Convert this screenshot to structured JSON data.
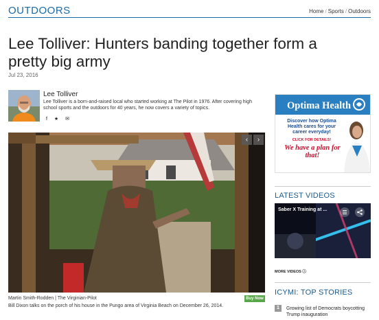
{
  "section": {
    "title": "OUTDOORS",
    "breadcrumbs": [
      "Home",
      "Sports",
      "Outdoors"
    ]
  },
  "article": {
    "headline": "Lee Tolliver: Hunters banding together form a pretty big army",
    "date": "Jul 23, 2016"
  },
  "author": {
    "name": "Lee Tolliver",
    "bio": "Lee Tolliver is a born-and-raised local who started working at The Pilot in 1976. After covering high school sports and the outdoors for 40 years, he now covers a variety of topics.",
    "share_icons": [
      "facebook-icon",
      "twitter-icon",
      "email-icon"
    ],
    "share_glyphs": [
      "f",
      "★",
      "✉"
    ]
  },
  "photo": {
    "credit": "Martin Smith-Rodden | The Virginian-Pilot",
    "buy_label": "Buy Now",
    "caption": "Bill Dixon talks on the porch of his house in the Pungo area of Virginia Beach on December 26, 2014.",
    "prev_glyph": "‹",
    "next_glyph": "›"
  },
  "ad": {
    "brand": "Optima Health",
    "line1": "Discover how Optima Health cares for your career everyday!",
    "click": "CLICK FOR DETAILS!",
    "line2": "We have a plan for that!"
  },
  "sidebar": {
    "latest_videos_label": "LATEST VIDEOS",
    "video_title": "Saber X Training at ...",
    "more_videos": "MORE VIDEOS ⓘ",
    "icymi_label": "ICYMI: TOP STORIES",
    "stories": [
      {
        "num": "1",
        "title": "Growing list of Democrats boycotting Trump inauguration"
      }
    ]
  },
  "colors": {
    "accent": "#1a6aa6",
    "buy_button": "#5aa64a",
    "ad_blue": "#2a7fc0",
    "ad_red": "#c8102e"
  }
}
